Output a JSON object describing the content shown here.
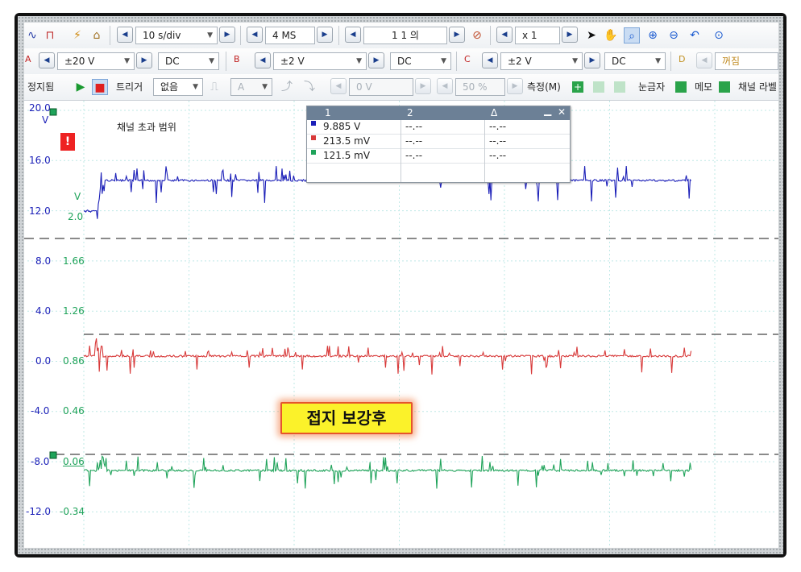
{
  "toolbar1": {
    "timebase": "10 s/div",
    "samples": "4 MS",
    "capture": "1 1 의",
    "zoom": "x 1"
  },
  "toolbar2": {
    "channels": [
      {
        "letter": "A",
        "range": "±20 V",
        "coupling": "DC"
      },
      {
        "letter": "B",
        "range": "±2 V",
        "coupling": "DC"
      },
      {
        "letter": "C",
        "range": "±2 V",
        "coupling": "DC"
      },
      {
        "letter": "D",
        "range": "꺼짐"
      }
    ]
  },
  "toolbar3": {
    "stop_label": "정지됨",
    "trigger_label": "트리거",
    "trigger_mode": "없음",
    "trigger_source": "A",
    "trigger_level": "0 V",
    "pretrigger": "50 %",
    "measure_label": "측정(M)",
    "ruler_label": "눈금자",
    "memo_label": "메모",
    "channel_label": "채널 라벨"
  },
  "plot": {
    "left_axis_unit": "V",
    "left_axis": [
      "20.0",
      "16.0",
      "12.0",
      "8.0",
      "4.0",
      "0.0",
      "-4.0",
      "-8.0",
      "-12.0"
    ],
    "inner_axis_unit": "V",
    "inner_axis": [
      "2.0",
      "1.66",
      "1.26",
      "0.86",
      "0.46",
      "0.06",
      "-0.34"
    ],
    "overrange_text": "채널 초과 범위",
    "overrange_badge": "!",
    "colors": {
      "A": "#1b1fb8",
      "B": "#d83a3a",
      "C": "#1fa35a"
    }
  },
  "measurements": {
    "headers": [
      "1",
      "2",
      "Δ"
    ],
    "rows": [
      {
        "color": "#1b1fb8",
        "v1": "9.885 V",
        "v2": "--.--",
        "delta": "--.--"
      },
      {
        "color": "#d83a3a",
        "v1": "213.5 mV",
        "v2": "--.--",
        "delta": "--.--"
      },
      {
        "color": "#1fa35a",
        "v1": "121.5 mV",
        "v2": "--.--",
        "delta": "--.--"
      }
    ]
  },
  "annotation": "접지 보강후"
}
